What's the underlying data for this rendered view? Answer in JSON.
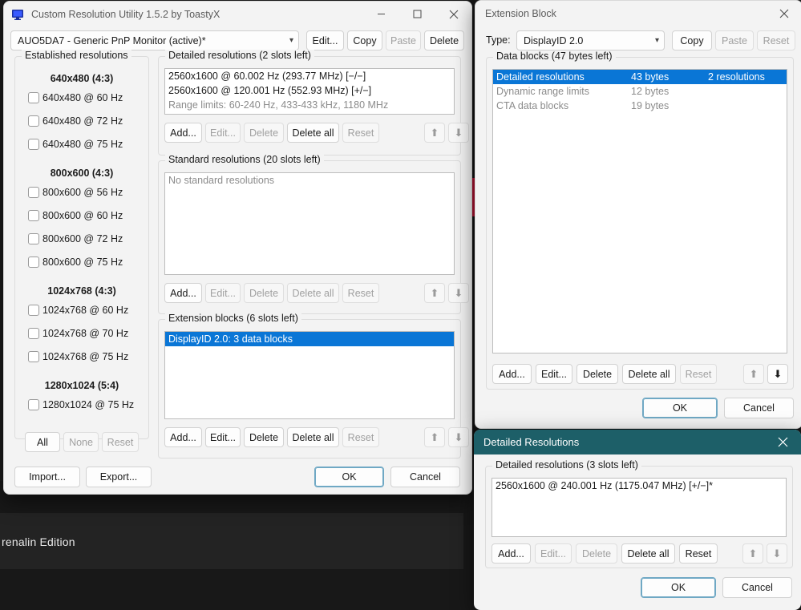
{
  "desktop": {
    "app_text": "renalin Edition"
  },
  "main_window": {
    "title": "Custom Resolution Utility 1.5.2 by ToastyX",
    "icon": "monitor-icon",
    "minimize": "minimize-icon",
    "maximize": "maximize-icon",
    "close": "close-icon",
    "monitor_select": {
      "value": "AUO5DA7 - Generic PnP Monitor (active)*",
      "arrow": "chevron-down-icon"
    },
    "top_buttons": [
      {
        "label": "Edit...",
        "enabled": true
      },
      {
        "label": "Copy",
        "enabled": true
      },
      {
        "label": "Paste",
        "enabled": false
      },
      {
        "label": "Delete",
        "enabled": true
      }
    ],
    "established": {
      "group_label": "Established resolutions",
      "sections": [
        {
          "heading": "640x480 (4:3)",
          "items": [
            {
              "label": "640x480 @ 60 Hz",
              "checked": false
            },
            {
              "label": "640x480 @ 72 Hz",
              "checked": false
            },
            {
              "label": "640x480 @ 75 Hz",
              "checked": false
            }
          ]
        },
        {
          "heading": "800x600 (4:3)",
          "items": [
            {
              "label": "800x600 @ 56 Hz",
              "checked": false
            },
            {
              "label": "800x600 @ 60 Hz",
              "checked": false
            },
            {
              "label": "800x600 @ 72 Hz",
              "checked": false
            },
            {
              "label": "800x600 @ 75 Hz",
              "checked": false
            }
          ]
        },
        {
          "heading": "1024x768 (4:3)",
          "items": [
            {
              "label": "1024x768 @ 60 Hz",
              "checked": false
            },
            {
              "label": "1024x768 @ 70 Hz",
              "checked": false
            },
            {
              "label": "1024x768 @ 75 Hz",
              "checked": false
            }
          ]
        },
        {
          "heading": "1280x1024 (5:4)",
          "items": [
            {
              "label": "1280x1024 @ 75 Hz",
              "checked": false
            }
          ]
        }
      ],
      "buttons": [
        {
          "label": "All",
          "enabled": true
        },
        {
          "label": "None",
          "enabled": false
        },
        {
          "label": "Reset",
          "enabled": false
        }
      ]
    },
    "detailed": {
      "group_label": "Detailed resolutions (2 slots left)",
      "rows": [
        {
          "text": "2560x1600 @ 60.002 Hz (293.77 MHz) [−/−]",
          "muted": false,
          "selected": false
        },
        {
          "text": "2560x1600 @ 120.001 Hz (552.93 MHz) [+/−]",
          "muted": false,
          "selected": false
        },
        {
          "text": "Range limits: 60-240 Hz, 433-433 kHz, 1180 MHz",
          "muted": true,
          "selected": false
        }
      ],
      "buttons": [
        {
          "label": "Add...",
          "enabled": true
        },
        {
          "label": "Edit...",
          "enabled": false
        },
        {
          "label": "Delete",
          "enabled": false
        },
        {
          "label": "Delete all",
          "enabled": true
        },
        {
          "label": "Reset",
          "enabled": false
        }
      ],
      "move_up": "arrow-up-icon",
      "move_down": "arrow-down-icon"
    },
    "standard": {
      "group_label": "Standard resolutions (20 slots left)",
      "rows": [
        {
          "text": "No standard resolutions",
          "muted": true,
          "selected": false
        }
      ],
      "buttons": [
        {
          "label": "Add...",
          "enabled": true
        },
        {
          "label": "Edit...",
          "enabled": false
        },
        {
          "label": "Delete",
          "enabled": false
        },
        {
          "label": "Delete all",
          "enabled": false
        },
        {
          "label": "Reset",
          "enabled": false
        }
      ],
      "move_up": "arrow-up-icon",
      "move_down": "arrow-down-icon"
    },
    "extension_blocks": {
      "group_label": "Extension blocks (6 slots left)",
      "rows": [
        {
          "text": "DisplayID 2.0: 3 data blocks",
          "muted": false,
          "selected": true
        }
      ],
      "buttons": [
        {
          "label": "Add...",
          "enabled": true
        },
        {
          "label": "Edit...",
          "enabled": true
        },
        {
          "label": "Delete",
          "enabled": true
        },
        {
          "label": "Delete all",
          "enabled": true
        },
        {
          "label": "Reset",
          "enabled": false
        }
      ],
      "move_up": "arrow-up-icon",
      "move_down": "arrow-down-icon"
    },
    "footer": {
      "import": "Import...",
      "export": "Export...",
      "ok": "OK",
      "cancel": "Cancel"
    }
  },
  "extension_window": {
    "title": "Extension Block",
    "close": "close-icon",
    "type_label": "Type:",
    "type_select": {
      "value": "DisplayID 2.0",
      "arrow": "chevron-down-icon"
    },
    "header_buttons": [
      {
        "label": "Copy",
        "enabled": true
      },
      {
        "label": "Paste",
        "enabled": false
      },
      {
        "label": "Reset",
        "enabled": false
      }
    ],
    "data_blocks": {
      "group_label": "Data blocks (47 bytes left)",
      "rows": [
        {
          "name": "Detailed resolutions",
          "bytes": "43 bytes",
          "extra": "2 resolutions",
          "selected": true
        },
        {
          "name": "Dynamic range limits",
          "bytes": "12 bytes",
          "extra": "",
          "selected": false
        },
        {
          "name": "CTA data blocks",
          "bytes": "19 bytes",
          "extra": "",
          "selected": false
        }
      ],
      "buttons": [
        {
          "label": "Add...",
          "enabled": true
        },
        {
          "label": "Edit...",
          "enabled": true
        },
        {
          "label": "Delete",
          "enabled": true
        },
        {
          "label": "Delete all",
          "enabled": true
        },
        {
          "label": "Reset",
          "enabled": false
        }
      ],
      "move_up": "arrow-up-icon",
      "move_down": "arrow-down-icon"
    },
    "footer": {
      "ok": "OK",
      "cancel": "Cancel"
    }
  },
  "detailed_window": {
    "title": "Detailed Resolutions",
    "close": "close-icon",
    "group_label": "Detailed resolutions (3 slots left)",
    "rows": [
      {
        "text": "2560x1600 @ 240.001 Hz (1175.047 MHz) [+/−]*",
        "muted": false,
        "selected": false
      }
    ],
    "buttons": [
      {
        "label": "Add...",
        "enabled": true
      },
      {
        "label": "Edit...",
        "enabled": false
      },
      {
        "label": "Delete",
        "enabled": false
      },
      {
        "label": "Delete all",
        "enabled": true
      },
      {
        "label": "Reset",
        "enabled": true
      }
    ],
    "move_up": "arrow-up-icon",
    "move_down": "arrow-down-icon",
    "footer": {
      "ok": "OK",
      "cancel": "Cancel"
    }
  },
  "colors": {
    "selection_blue": "#0a76d6",
    "active_title": "#1d5f68",
    "accent_red": "#e4163f",
    "window_face": "#f3f3f3"
  }
}
